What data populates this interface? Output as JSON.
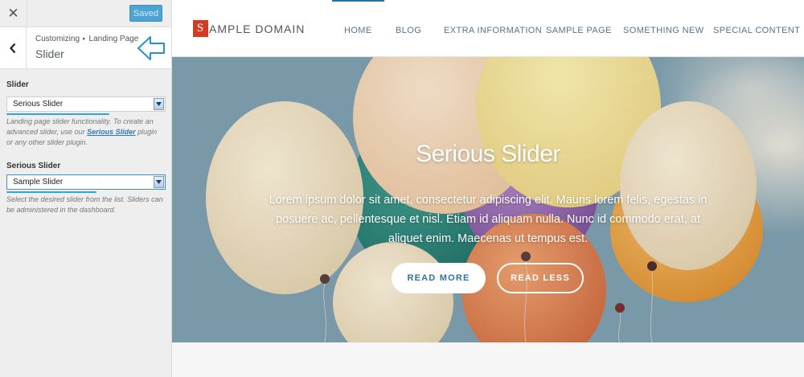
{
  "customizer": {
    "close_glyph": "✕",
    "saved_label": "Saved",
    "breadcrumb": {
      "parent": "Customizing",
      "sep": "▸",
      "current": "Landing Page"
    },
    "section_title": "Slider",
    "controls": [
      {
        "label": "Slider",
        "value": "Serious Slider",
        "desc_before": "Landing page slider functionality. To create an advanced slider, use our ",
        "desc_link": "Serious Slider",
        "desc_after": " plugin or any other slider plugin."
      },
      {
        "label": "Serious Slider",
        "value": "Sample Slider",
        "desc": "Select the desired slider from the list. Sliders can be administered in the dashboard."
      }
    ]
  },
  "site": {
    "logo_letter": "S",
    "logo_text": "AMPLE DOMAIN",
    "nav": [
      "HOME",
      "BLOG",
      "EXTRA INFORMATION",
      "SAMPLE PAGE",
      "SOMETHING NEW",
      "SPECIAL CONTENT"
    ],
    "active_nav": "HOME"
  },
  "slider": {
    "title": "Serious Slider",
    "text": "Lorem ipsum dolor sit amet, consectetur adipiscing elit. Mauris lorem felis, egestas in posuere ac, pellentesque et nisl. Etiam id aliquam nulla. Nunc id commodo erat, at aliquet enim. Maecenas ut tempus est.",
    "button_primary": "READ MORE",
    "button_secondary": "READ LESS"
  },
  "colors": {
    "accent": "#2da5d8",
    "saved_button": "#4da3d4",
    "logo_badge": "#d33b25",
    "sky": "#7f9fae",
    "nav_text": "#5b7388"
  }
}
